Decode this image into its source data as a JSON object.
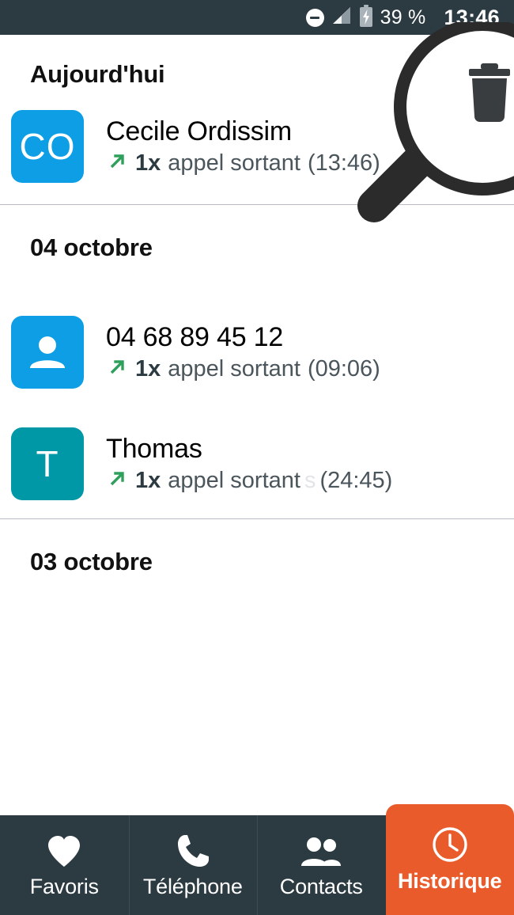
{
  "status_bar": {
    "dnd_icon": "do-not-disturb-icon",
    "signal_icon": "signal-bars-icon",
    "battery_icon": "battery-charging-icon",
    "battery_text": "39 %",
    "clock": "13:46",
    "background": "#2c3a42"
  },
  "overlay": {
    "magnifier_icon": "magnifier-icon",
    "inner_icon": "trash-icon",
    "color": "#2b2b2b"
  },
  "sections": [
    {
      "header": "Aujourd'hui",
      "rows": [
        {
          "avatar_type": "initials",
          "avatar_text": "CO",
          "avatar_color": "#0d9ee6",
          "title": "Cecile Ordissim",
          "direction_icon": "outgoing-call-arrow-icon",
          "count": "1x",
          "detail": "appel sortant",
          "time": "(13:46)"
        }
      ]
    },
    {
      "header": "04 octobre",
      "rows": [
        {
          "avatar_type": "person",
          "avatar_text": "",
          "avatar_color": "#0d9ee6",
          "title": "04 68 89 45 12",
          "direction_icon": "outgoing-call-arrow-icon",
          "count": "1x",
          "detail": "appel sortant",
          "time": "(09:06)"
        },
        {
          "avatar_type": "initials",
          "avatar_text": "T",
          "avatar_color": "#0097a7",
          "title": "Thomas",
          "direction_icon": "outgoing-call-arrow-icon",
          "count": "1x",
          "detail": "appel sortant",
          "ghost": "s",
          "time": "(24:45)"
        }
      ]
    },
    {
      "header": "03 octobre",
      "rows": []
    }
  ],
  "bottom_nav": {
    "active_color": "#ea5b2c",
    "inactive_color": "#2c3a42",
    "items": [
      {
        "label": "Favoris",
        "icon": "heart-icon",
        "active": false
      },
      {
        "label": "Téléphone",
        "icon": "phone-icon",
        "active": false
      },
      {
        "label": "Contacts",
        "icon": "people-icon",
        "active": false
      },
      {
        "label": "Historique",
        "icon": "clock-icon",
        "active": true
      }
    ]
  }
}
